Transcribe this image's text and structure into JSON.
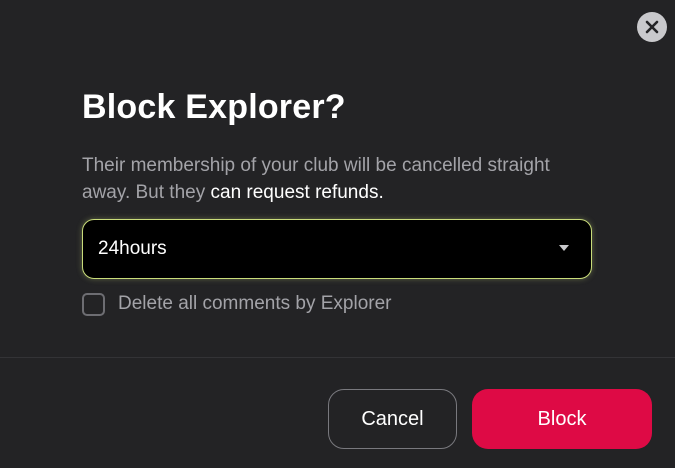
{
  "dialog": {
    "title": "Block Explorer?",
    "description_prefix": "Their membership of your club will be cancelled straight away. But they ",
    "description_link": "can request refunds.",
    "duration_select": {
      "value": "24hours"
    },
    "delete_comments_checkbox": {
      "label": "Delete all comments by Explorer",
      "checked": false
    },
    "buttons": {
      "cancel_label": "Cancel",
      "block_label": "Block"
    },
    "icons": {
      "close": "close-icon",
      "dropdown": "caret-down-icon"
    }
  },
  "colors": {
    "background": "#232325",
    "accent_block": "#de0a45",
    "select_focus_border": "#c9dc7a",
    "muted_text": "#a3a3a8"
  }
}
